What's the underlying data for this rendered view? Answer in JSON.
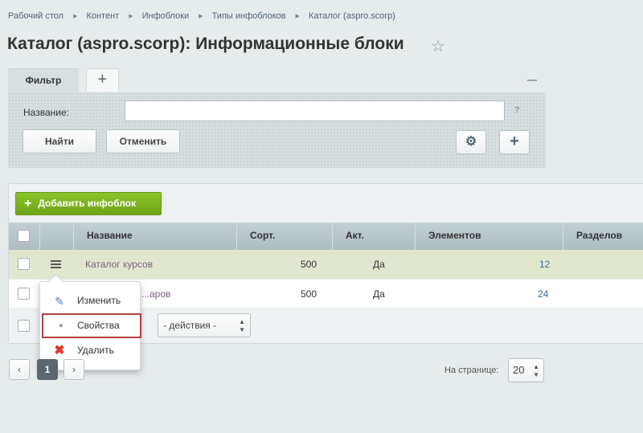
{
  "breadcrumb": [
    "Рабочий стол",
    "Контент",
    "Инфоблоки",
    "Типы инфоблоков",
    "Каталог (aspro.scorp)"
  ],
  "page_title": "Каталог (aspro.scorp): Информационные блоки",
  "filter": {
    "tab_label": "Фильтр",
    "field_label": "Название:",
    "field_value": "",
    "help": "?",
    "find_label": "Найти",
    "cancel_label": "Отменить"
  },
  "toolbar": {
    "add_label": "Добавить инфоблок"
  },
  "grid": {
    "columns": [
      "Название",
      "Сорт.",
      "Акт.",
      "Элементов",
      "Разделов"
    ],
    "rows": [
      {
        "name": "Каталог курсов",
        "sort": "500",
        "active": "Да",
        "elements": "12"
      },
      {
        "name": "...аров",
        "sort": "500",
        "active": "Да",
        "elements": "24"
      }
    ],
    "actions_select": "- действия -"
  },
  "context_menu": {
    "items": [
      {
        "label": "Изменить",
        "icon": "edit-icon"
      },
      {
        "label": "Свойства",
        "icon": "dot-icon"
      },
      {
        "label": "Удалить",
        "icon": "delete-icon"
      }
    ]
  },
  "pager": {
    "prev": "‹",
    "current": "1",
    "next": "›",
    "per_page_label": "На странице:",
    "per_page_value": "20"
  },
  "colors": {
    "accent_green": "#7cb41f",
    "highlight_row": "#e1e7cf",
    "menu_outline": "#b1413b"
  }
}
